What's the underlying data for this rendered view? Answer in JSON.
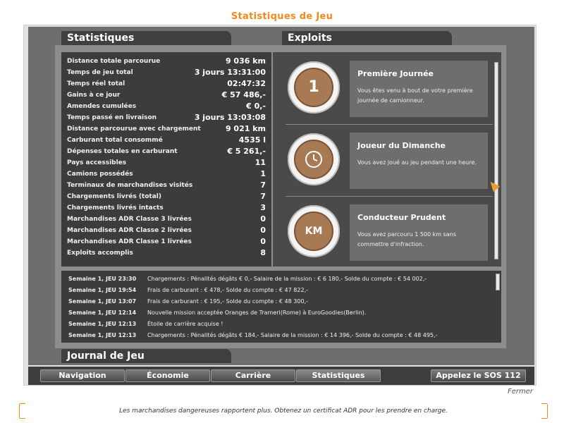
{
  "title": "Statistiques de Jeu",
  "tabs": {
    "stats": "Statistiques",
    "exploits": "Exploits",
    "journal": "Journal de Jeu"
  },
  "stats": [
    {
      "label": "Distance totale parcourue",
      "value": "9 036 km"
    },
    {
      "label": "Temps de jeu total",
      "value": "3 jours 13:31:00"
    },
    {
      "label": "Temps réel total",
      "value": "02:47:32"
    },
    {
      "label": "Gains à ce jour",
      "value": "€ 57 486,-"
    },
    {
      "label": "Amendes cumulées",
      "value": "€ 0,-"
    },
    {
      "label": "Temps passé en livraison",
      "value": "3 jours 13:03:08"
    },
    {
      "label": "Distance parcourue avec chargement",
      "value": "9 021 km"
    },
    {
      "label": "Carburant total consommé",
      "value": "4535 l"
    },
    {
      "label": "Dépenses totales en carburant",
      "value": "€ 5 261,-"
    },
    {
      "label": "Pays accessibles",
      "value": "11"
    },
    {
      "label": "Camions possédés",
      "value": "1"
    },
    {
      "label": "Terminaux de marchandises visités",
      "value": "7"
    },
    {
      "label": "Chargements livrés (total)",
      "value": "7"
    },
    {
      "label": "Chargements livrés intacts",
      "value": "3"
    },
    {
      "label": "Marchandises ADR Classe 3 livrées",
      "value": "0"
    },
    {
      "label": "Marchandises ADR Classe 2 livrées",
      "value": "0"
    },
    {
      "label": "Marchandises ADR Classe 1 livrées",
      "value": "0"
    },
    {
      "label": "Exploits accomplis",
      "value": "8"
    }
  ],
  "achievements": [
    {
      "badge": "1",
      "title": "Première Journée",
      "desc": "Vous êtes venu à bout de votre première journée de camionneur."
    },
    {
      "badge": "clock",
      "title": "Joueur du Dimanche",
      "desc": "Vous avez joué au jeu pendant une heure."
    },
    {
      "badge": "KM",
      "title": "Conducteur Prudent",
      "desc": "Vous avez parcouru 1 500 km sans commettre d'infraction."
    }
  ],
  "log": [
    {
      "time": "Semaine 1, JEU 23:30",
      "msg": "Chargements : Pénalités dégâts € 0,- Salaire de la mission : € 6 180,- Solde du compte : € 54 002,-"
    },
    {
      "time": "Semaine 1, JEU 19:54",
      "msg": "Frais de carburant : € 478,- Solde du compte : € 47 822,-"
    },
    {
      "time": "Semaine 1, JEU 13:07",
      "msg": "Frais de carburant : € 195,- Solde du compte : € 48 300,-"
    },
    {
      "time": "Semaine 1, JEU 12:14",
      "msg": "Nouvelle mission acceptée Oranges de Trameri(Rome) à EuroGoodies(Berlin)."
    },
    {
      "time": "Semaine 1, JEU 12:13",
      "msg": "Étoile de carrière acquise !"
    },
    {
      "time": "Semaine 1, JEU 12:13",
      "msg": "Chargements : Pénalités dégâts € 184,- Salaire de la mission : € 14 396,- Solde du compte : € 48 495,-"
    }
  ],
  "nav": {
    "navigation": "Navigation",
    "economie": "Économie",
    "carriere": "Carrière",
    "statistiques": "Statistiques",
    "sos": "Appelez le SOS 112"
  },
  "fermer": "Fermer",
  "tip": "Les marchandises dangereuses rapportent plus. Obtenez un certificat ADR pour les prendre en charge.",
  "colors": {
    "accent": "#f08a1c",
    "panel": "#3c3c3c",
    "medal": "#a87a54"
  }
}
